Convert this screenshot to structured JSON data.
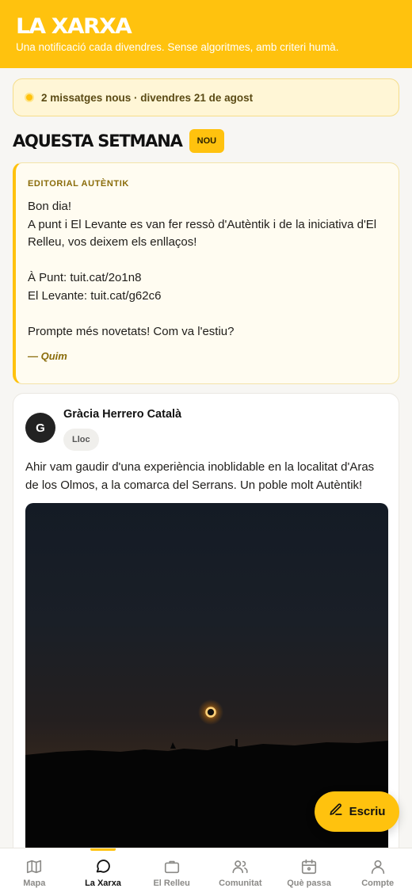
{
  "header": {
    "title": "LA XARXA",
    "subtitle": "Una notificació cada divendres. Sense algoritmes, amb criteri humà."
  },
  "notice": {
    "text": "2 missatges nous · divendres 21 de agost"
  },
  "section": {
    "title": "AQUESTA SETMANA",
    "badge": "NOU"
  },
  "editorial": {
    "label": "EDITORIAL AUTÈNTIK",
    "lines": [
      "Bon dia!",
      "A punt i El Levante es van fer ressò d'Autèntik i de la iniciativa d'El",
      "Relleu, vos deixem els enllaços!",
      "",
      "À Punt: tuit.cat/2o1n8",
      "El Levante: tuit.cat/g62c6",
      "",
      "Prompte més novetats! Com va l'estiu?"
    ],
    "signature": "— Quim"
  },
  "post": {
    "avatar_letter": "G",
    "author": "Gràcia Herrero Català",
    "tag": "Lloc",
    "body": "Ahir vam gaudir d'una experiència inoblidable en la localitat d'Aras de los Olmos, a la comarca del Serrans. Un poble molt Autèntik!"
  },
  "fab": {
    "label": "Escriu",
    "icon": "pencil-icon"
  },
  "tabs": [
    {
      "label": "Mapa",
      "icon": "map-icon",
      "active": false
    },
    {
      "label": "La Xarxa",
      "icon": "chat-bubble-icon",
      "active": true
    },
    {
      "label": "El Relleu",
      "icon": "briefcase-icon",
      "active": false
    },
    {
      "label": "Comunitat",
      "icon": "people-icon",
      "active": false
    },
    {
      "label": "Què passa",
      "icon": "calendar-icon",
      "active": false
    },
    {
      "label": "Compte",
      "icon": "user-icon",
      "active": false
    }
  ],
  "colors": {
    "accent": "#ffc20e",
    "background": "#f7f6f3",
    "notice_bg": "#fff6d6",
    "editorial_label": "#8a6c0a"
  }
}
